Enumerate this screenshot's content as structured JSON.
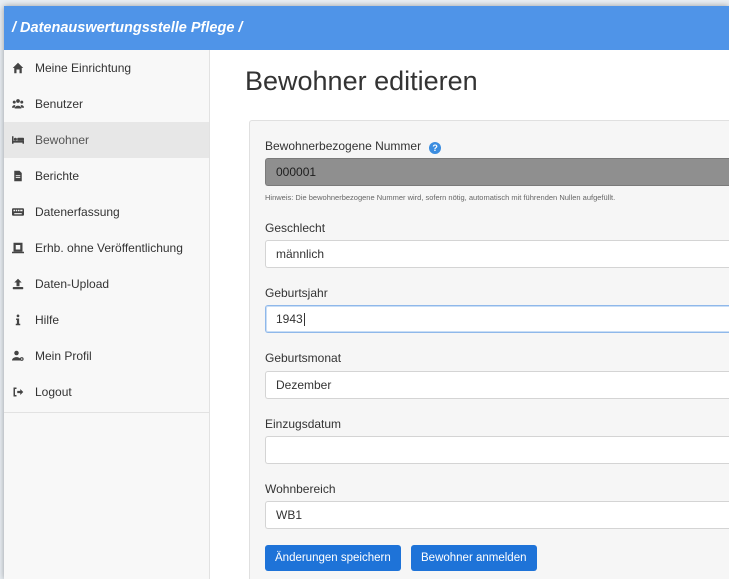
{
  "header": {
    "title": "/ Datenauswertungsstelle Pflege /"
  },
  "sidebar": {
    "items": [
      {
        "label": "Meine Einrichtung",
        "icon": "home-icon"
      },
      {
        "label": "Benutzer",
        "icon": "users-icon"
      },
      {
        "label": "Bewohner",
        "icon": "bed-icon",
        "active": true
      },
      {
        "label": "Berichte",
        "icon": "document-icon"
      },
      {
        "label": "Datenerfassung",
        "icon": "keyboard-icon"
      },
      {
        "label": "Erhb. ohne Veröffentlichung",
        "icon": "export-icon"
      },
      {
        "label": "Daten-Upload",
        "icon": "upload-icon"
      },
      {
        "label": "Hilfe",
        "icon": "info-icon"
      },
      {
        "label": "Mein Profil",
        "icon": "user-cog-icon"
      },
      {
        "label": "Logout",
        "icon": "logout-icon"
      }
    ]
  },
  "main": {
    "title": "Bewohner editieren",
    "form": {
      "resident_number": {
        "label": "Bewohnerbezogene Nummer",
        "value": "000001",
        "help": "?"
      },
      "hint": "Hinweis: Die bewohnerbezogene Nummer wird, sofern nötig, automatisch mit führenden Nullen aufgefüllt.",
      "gender": {
        "label": "Geschlecht",
        "value": "männlich"
      },
      "birth_year": {
        "label": "Geburtsjahr",
        "value": "1943"
      },
      "birth_month": {
        "label": "Geburtsmonat",
        "value": "Dezember"
      },
      "move_in_date": {
        "label": "Einzugsdatum",
        "value": ""
      },
      "living_area": {
        "label": "Wohnbereich",
        "value": "WB1"
      }
    },
    "buttons": {
      "save": "Änderungen speichern",
      "register": "Bewohner anmelden"
    }
  },
  "colors": {
    "header": "#4f94e8",
    "primary_button": "#1e73d8",
    "readonly_input": "#8f8f8f",
    "help_icon": "#3b8de0"
  }
}
